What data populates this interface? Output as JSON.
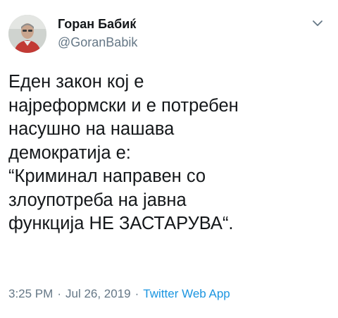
{
  "author": {
    "display_name": "Горан Бабиќ",
    "handle": "@GoranBabik"
  },
  "tweet": {
    "lines": [
      "Еден закон кој е",
      "најреформски и е потребен",
      "насушно на нашава",
      "демократија е:",
      "“Криминал направен со",
      "злоупотреба на јавна",
      "функција НЕ ЗАСТАРУВА“."
    ],
    "time": "3:25 PM",
    "date": "Jul 26, 2019",
    "separator": "·",
    "source": "Twitter Web App"
  },
  "icons": {
    "caret": "chevron-down-icon",
    "avatar": "avatar"
  },
  "colors": {
    "text": "#14171a",
    "secondary": "#657786",
    "link": "#1b95e0"
  }
}
